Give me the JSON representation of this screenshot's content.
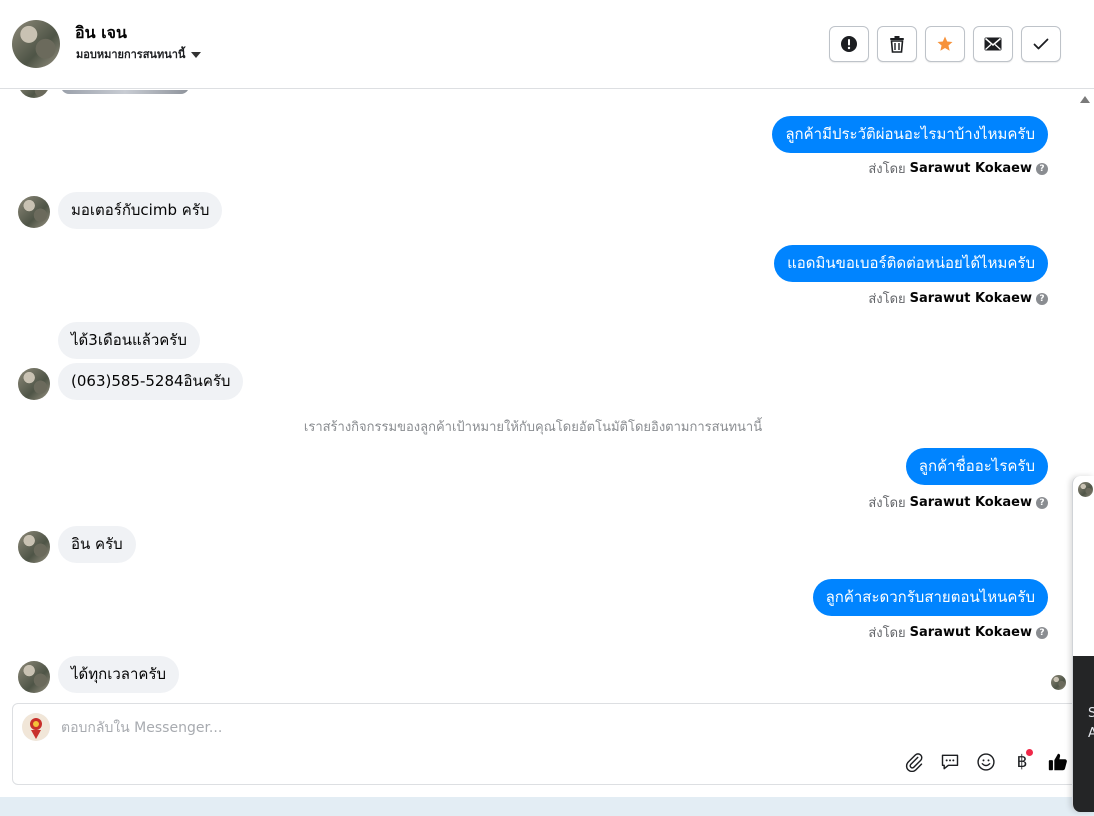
{
  "header": {
    "contact_name": "อิน เจน",
    "assign_label": "มอบหมายการสนทนานี้",
    "actions": [
      {
        "name": "spam-button",
        "icon": "exclamation-icon"
      },
      {
        "name": "delete-button",
        "icon": "trash-icon"
      },
      {
        "name": "star-button",
        "icon": "star-icon",
        "color": "#f7923a"
      },
      {
        "name": "mark-unread-button",
        "icon": "envelope-icon"
      },
      {
        "name": "mark-done-button",
        "icon": "check-icon"
      }
    ]
  },
  "messages": [
    {
      "direction": "out",
      "text": "ลูกค้ามีประวัติผ่อนอะไรมาบ้างไหมครับ",
      "sender_prefix": "ส่งโดย",
      "sender": "Sarawut Kokaew"
    },
    {
      "direction": "in",
      "text": "มอเตอร์กับcimb ครับ"
    },
    {
      "direction": "out",
      "text": "แอดมินขอเบอร์ติดต่อหน่อยได้ไหมครับ",
      "sender_prefix": "ส่งโดย",
      "sender": "Sarawut Kokaew"
    },
    {
      "direction": "in",
      "text": "ได้3เดือนแล้วครับ"
    },
    {
      "direction": "in",
      "text": "(063)585-5284อินครับ"
    },
    {
      "direction": "system",
      "text": "เราสร้างกิจกรรมของลูกค้าเป้าหมายให้กับคุณโดยอัตโนมัติโดยอิงตามการสนทนานี้"
    },
    {
      "direction": "out",
      "text": "ลูกค้าชื่ออะไรครับ",
      "sender_prefix": "ส่งโดย",
      "sender": "Sarawut Kokaew"
    },
    {
      "direction": "in",
      "text": "อิน  ครับ"
    },
    {
      "direction": "out",
      "text": "ลูกค้าสะดวกรับสายตอนไหนครับ",
      "sender_prefix": "ส่งโดย",
      "sender": "Sarawut Kokaew"
    },
    {
      "direction": "in",
      "text": "ได้ทุกเวลาครับ"
    }
  ],
  "composer": {
    "placeholder": "ตอบกลับใน Messenger...",
    "tools": [
      "paperclip-icon",
      "saved-reply-icon",
      "emoji-icon",
      "baht-payment-icon",
      "thumbs-up-icon"
    ],
    "like_color": "#050505",
    "notification_dot_color": "#f02849"
  },
  "side_panel": {
    "line1": "S",
    "line2": "A"
  },
  "colors": {
    "outgoing_bubble": "#0084ff",
    "incoming_bubble": "#f0f2f5"
  }
}
